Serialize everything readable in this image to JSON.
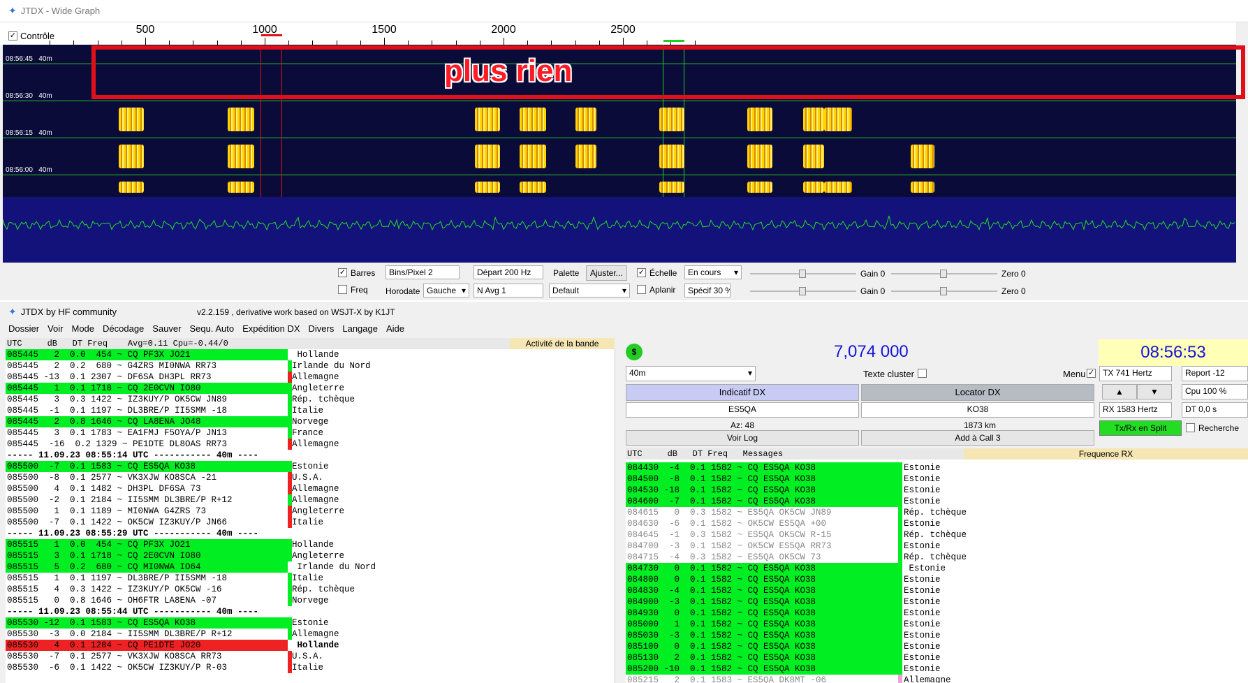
{
  "wide": {
    "title": "JTDX - Wide Graph",
    "controle": "Contrôle",
    "ruler": [
      "500",
      "1000",
      "1500",
      "2000",
      "2500"
    ],
    "times": [
      {
        "t": "08:56:45",
        "b": "40m"
      },
      {
        "t": "08:56:30",
        "b": "40m"
      },
      {
        "t": "08:56:15",
        "b": "40m"
      },
      {
        "t": "08:56:00",
        "b": "40m"
      }
    ],
    "annotation": "plus rien",
    "toolbar": {
      "barres": "Barres",
      "freq": "Freq",
      "bins": "Bins/Pixel  2",
      "depart": "Départ 200 Hz",
      "horodate": "Horodate",
      "gauche": "Gauche",
      "navg": "N Avg 1",
      "palette": "Palette",
      "ajuster": "Ajuster...",
      "default": "Default",
      "echelle": "Échelle",
      "aplanir": "Aplanir",
      "encours": "En cours",
      "specif": "Spécif 30 %",
      "gain1": "Gain 0",
      "zero1": "Zero 0",
      "gain2": "Gain 0",
      "zero2": "Zero 0"
    }
  },
  "main": {
    "title": "JTDX  by HF community",
    "version": "v2.2.159 , derivative work based on WSJT-X by K1JT",
    "menu": [
      "Dossier",
      "Voir",
      "Mode",
      "Décodage",
      "Sauver",
      "Sequ. Auto",
      "Expédition DX",
      "Divers",
      "Langage",
      "Aide"
    ],
    "band_header": "UTC     dB   DT Freq    Avg=0.11 Cpu=-0.44/0",
    "band_activity": "Activité de la bande",
    "left_rows": [
      {
        "t": "085445   2  0.0  454 ~ CQ PF3X JO21",
        "c": " Hollande",
        "hl": "green",
        "m": ""
      },
      {
        "t": "085445   2  0.2  680 ~ G4ZRS MI0NWA RR73",
        "c": "Irlande du Nord",
        "hl": "",
        "m": "green"
      },
      {
        "t": "085445 -13  0.1 2307 ~ DF6SA DH3PL RR73",
        "c": "Allemagne",
        "hl": "",
        "m": "red"
      },
      {
        "t": "085445   1  0.1 1718 ~ CQ 2E0CVN IO80",
        "c": "Angleterre",
        "hl": "green",
        "m": "green"
      },
      {
        "t": "085445   3  0.3 1422 ~ IZ3KUY/P OK5CW JN89",
        "c": "Rép. tchèque",
        "hl": "",
        "m": "green"
      },
      {
        "t": "085445  -1  0.1 1197 ~ DL3BRE/P II5SMM -18",
        "c": "Italie",
        "hl": "",
        "m": "green"
      },
      {
        "t": "085445   2  0.8 1646 ~ CQ LA8ENA JO48",
        "c": "Norvege",
        "hl": "green",
        "m": "green"
      },
      {
        "t": "085445   3  0.1 1783 ~ EA1FMJ F5OYA/P JN13",
        "c": "France",
        "hl": "",
        "m": "green"
      },
      {
        "t": "085445  -16  0.2 1329 ~ PE1DTE DL8OAS RR73",
        "c": "Allemagne",
        "hl": "",
        "m": "red"
      },
      {
        "t": "----- 11.09.23 08:55:14 UTC ----------- 40m ----",
        "c": "",
        "hl": "sep",
        "m": ""
      },
      {
        "t": "085500  -7  0.1 1583 ~ CQ ES5QA KO38",
        "c": "Estonie",
        "hl": "green",
        "m": "green"
      },
      {
        "t": "085500  -8  0.1 2577 ~ VK3XJW KO8SCA -21",
        "c": "U.S.A.",
        "hl": "",
        "m": "red"
      },
      {
        "t": "085500   4  0.1 1482 ~ DH3PL DF6SA 73",
        "c": "Allemagne",
        "hl": "",
        "m": "red"
      },
      {
        "t": "085500  -2  0.1 2184 ~ II5SMM DL3BRE/P R+12",
        "c": "Allemagne",
        "hl": "",
        "m": "green"
      },
      {
        "t": "085500   1  0.1 1189 ~ MI0NWA G4ZRS 73",
        "c": "Angleterre",
        "hl": "",
        "m": "red"
      },
      {
        "t": "085500  -7  0.1 1422 ~ OK5CW IZ3KUY/P JN66",
        "c": "Italie",
        "hl": "",
        "m": "red"
      },
      {
        "t": "----- 11.09.23 08:55:29 UTC ----------- 40m ----",
        "c": "",
        "hl": "sep",
        "m": ""
      },
      {
        "t": "085515   1  0.0  454 ~ CQ PF3X JO21",
        "c": "Hollande",
        "hl": "green",
        "m": "green"
      },
      {
        "t": "085515   3  0.1 1718 ~ CQ 2E0CVN IO80",
        "c": "Angleterre",
        "hl": "green",
        "m": "green"
      },
      {
        "t": "085515   5  0.2  680 ~ CQ MI0NWA IO64",
        "c": " Irlande du Nord",
        "hl": "green",
        "m": ""
      },
      {
        "t": "085515   1  0.1 1197 ~ DL3BRE/P II5SMM -18",
        "c": "Italie",
        "hl": "",
        "m": "green"
      },
      {
        "t": "085515   4  0.3 1422 ~ IZ3KUY/P OK5CW -16",
        "c": "Rép. tchèque",
        "hl": "",
        "m": "green"
      },
      {
        "t": "085515   0  0.8 1646 ~ OH6FTR LA8ENA -07",
        "c": "Norvege",
        "hl": "",
        "m": "green"
      },
      {
        "t": "----- 11.09.23 08:55:44 UTC ----------- 40m ----",
        "c": "",
        "hl": "sep",
        "m": ""
      },
      {
        "t": "085530 -12  0.1 1583 ~ CQ ES5QA KO38",
        "c": "Estonie",
        "hl": "green",
        "m": "green"
      },
      {
        "t": "085530  -3  0.0 2184 ~ II5SMM DL3BRE/P R+12",
        "c": "Allemagne",
        "hl": "",
        "m": "green"
      },
      {
        "t": "085530   4  0.1 1284 ~ CQ PE1DTE JO20",
        "c": " Hollande",
        "hl": "red",
        "m": ""
      },
      {
        "t": "085530  -7  0.1 2577 ~ VK3XJW KO8SCA RR73",
        "c": "U.S.A.",
        "hl": "",
        "m": "red"
      },
      {
        "t": "085530  -6  0.1 1422 ~ OK5CW IZ3KUY/P R-03",
        "c": "Italie",
        "hl": "",
        "m": "red"
      }
    ],
    "freq": "7,074 000",
    "clock": "08:56:53",
    "band": "40m",
    "texte_cluster": "Texte cluster",
    "menu_lbl": "Menu",
    "tx": "TX  741  Hertz",
    "report": "Report -12",
    "indicatif": "Indicatif DX",
    "locator": "Locator DX",
    "callsign": "ES5QA",
    "grid": "KO38",
    "az": "Az: 48",
    "dist": "1873 km",
    "cpu": "Cpu  100 %",
    "rx": "RX  1583  Hertz",
    "dt": "DT 0,0 s",
    "voir_log": "Voir Log",
    "add_call": "Add à Call 3",
    "split": "Tx/Rx en Split",
    "recherche": "Recherche",
    "rx_header": "UTC     dB   DT Freq   Messages",
    "freq_rx": "Frequence RX",
    "right_rows": [
      {
        "t": "084430  -4  0.1 1582 ~ CQ ES5QA KO38",
        "c": "Estonie",
        "hl": "green"
      },
      {
        "t": "084500  -8  0.1 1582 ~ CQ ES5QA KO38",
        "c": "Estonie",
        "hl": "green"
      },
      {
        "t": "084530 -18  0.1 1582 ~ CQ ES5QA KO38",
        "c": "Estonie",
        "hl": "green"
      },
      {
        "t": "084600  -7  0.1 1582 ~ CQ ES5QA KO38",
        "c": "Estonie",
        "hl": "green"
      },
      {
        "t": "084615   0  0.3 1582 ~ ES5QA OK5CW JN89",
        "c": "Rép. tchèque",
        "hl": "grey"
      },
      {
        "t": "084630  -6  0.1 1582 ~ OK5CW ES5QA +00",
        "c": "Estonie",
        "hl": "grey"
      },
      {
        "t": "084645  -1  0.3 1582 ~ ES5QA OK5CW R-15",
        "c": "Rép. tchèque",
        "hl": "grey"
      },
      {
        "t": "084700  -3  0.1 1582 ~ OK5CW ES5QA RR73",
        "c": "Estonie",
        "hl": "grey"
      },
      {
        "t": "084715  -4  0.3 1582 ~ ES5QA OK5CW 73",
        "c": "Rép. tchèque",
        "hl": "grey"
      },
      {
        "t": "084730   0  0.1 1582 ~ CQ ES5QA KO38",
        "c": " Estonie",
        "hl": "green"
      },
      {
        "t": "084800   0  0.1 1582 ~ CQ ES5QA KO38",
        "c": "Estonie",
        "hl": "green"
      },
      {
        "t": "084830  -4  0.1 1582 ~ CQ ES5QA KO38",
        "c": "Estonie",
        "hl": "green"
      },
      {
        "t": "084900  -3  0.1 1582 ~ CQ ES5QA KO38",
        "c": "Estonie",
        "hl": "green"
      },
      {
        "t": "084930   0  0.1 1582 ~ CQ ES5QA KO38",
        "c": "Estonie",
        "hl": "green"
      },
      {
        "t": "085000   1  0.1 1582 ~ CQ ES5QA KO38",
        "c": "Estonie",
        "hl": "green"
      },
      {
        "t": "085030  -3  0.1 1582 ~ CQ ES5QA KO38",
        "c": "Estonie",
        "hl": "green"
      },
      {
        "t": "085100   0  0.1 1582 ~ CQ ES5QA KO38",
        "c": "Estonie",
        "hl": "green"
      },
      {
        "t": "085130   2  0.1 1582 ~ CQ ES5QA KO38",
        "c": "Estonie",
        "hl": "green"
      },
      {
        "t": "085200 -10  0.1 1582 ~ CQ ES5QA KO38",
        "c": "Estonie",
        "hl": "green"
      },
      {
        "t": "085215   2  0.1 1583 ~ ES5QA DK8MT -06",
        "c": "Allemagne",
        "hl": "grey"
      }
    ]
  },
  "colors": {
    "green": "#00ee22",
    "red": "#ee2222",
    "accent": "#1515d8"
  }
}
